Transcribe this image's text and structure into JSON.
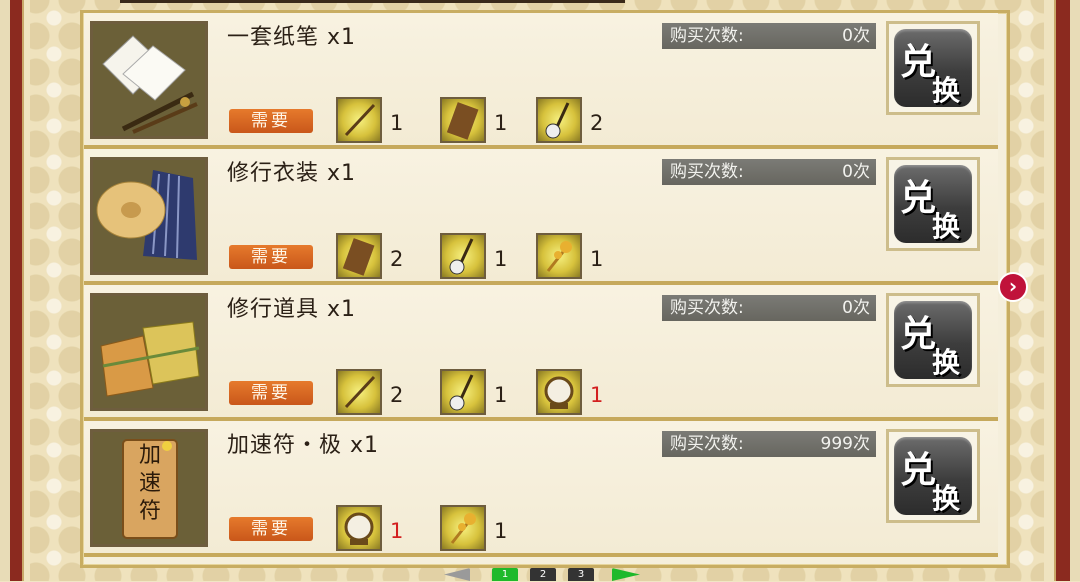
{
  "rows": [
    {
      "title": "一套纸笔 x1",
      "count_label": "购买次数:",
      "count_value": "0次",
      "need_label": "需要",
      "requirements": [
        {
          "icon": "brush-icon",
          "qty": "1",
          "red": false
        },
        {
          "icon": "koto-icon",
          "qty": "1",
          "red": false
        },
        {
          "icon": "shamisen-icon",
          "qty": "2",
          "red": false
        }
      ],
      "button": [
        "兑",
        "换"
      ]
    },
    {
      "title": "修行衣装 x1",
      "count_label": "购买次数:",
      "count_value": "0次",
      "need_label": "需要",
      "requirements": [
        {
          "icon": "koto-icon",
          "qty": "2",
          "red": false
        },
        {
          "icon": "shamisen-icon",
          "qty": "1",
          "red": false
        },
        {
          "icon": "bell-staff-icon",
          "qty": "1",
          "red": false
        }
      ],
      "button": [
        "兑",
        "换"
      ]
    },
    {
      "title": "修行道具 x1",
      "count_label": "购买次数:",
      "count_value": "0次",
      "need_label": "需要",
      "requirements": [
        {
          "icon": "brush-icon",
          "qty": "2",
          "red": false
        },
        {
          "icon": "shamisen-icon",
          "qty": "1",
          "red": false
        },
        {
          "icon": "drum-icon",
          "qty": "1",
          "red": true
        }
      ],
      "button": [
        "兑",
        "换"
      ]
    },
    {
      "title": "加速符・极 x1",
      "count_label": "购买次数:",
      "count_value": "999次",
      "need_label": "需要",
      "requirements": [
        {
          "icon": "drum-icon",
          "qty": "1",
          "red": true
        },
        {
          "icon": "bell-staff-icon",
          "qty": "1",
          "red": false
        }
      ],
      "button": [
        "兑",
        "换"
      ],
      "thumb_text": "加速符"
    }
  ],
  "pager": {
    "pages": [
      "1",
      "2",
      "3"
    ],
    "active": "1"
  },
  "colors": {
    "accent_orange": "#d9661f",
    "frame_gold": "#c6a95c",
    "alert_red": "#d32020",
    "pager_active": "#1fb92b"
  }
}
